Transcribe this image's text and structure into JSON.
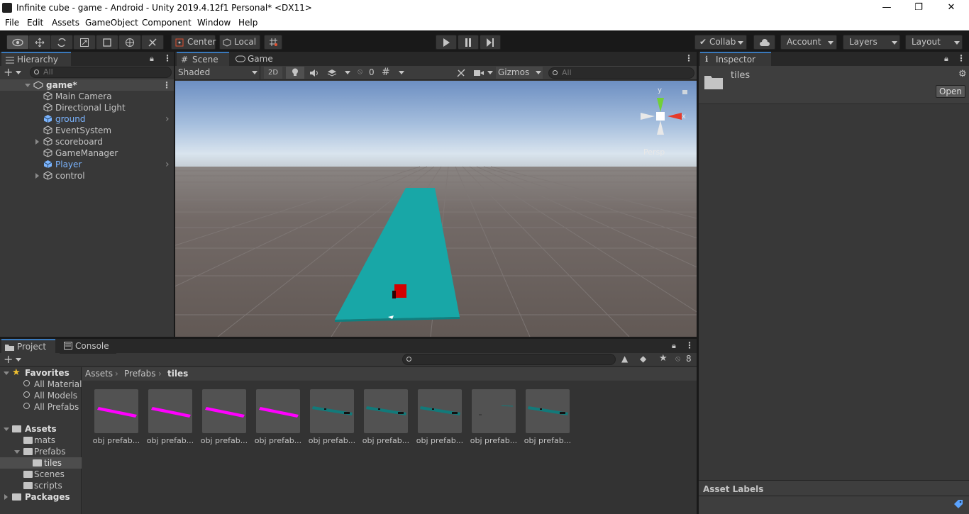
{
  "window": {
    "title": "Infinite cube - game - Android - Unity 2019.4.12f1 Personal* <DX11>"
  },
  "menu": [
    "File",
    "Edit",
    "Assets",
    "GameObject",
    "Component",
    "Window",
    "Help"
  ],
  "toolbar": {
    "center_label": "Center",
    "local_label": "Local",
    "collab_label": "Collab",
    "account_label": "Account",
    "layers_label": "Layers",
    "layout_label": "Layout"
  },
  "hierarchy": {
    "tab": "Hierarchy",
    "search_placeholder": "All",
    "scene": "game*",
    "items": [
      {
        "label": "Main Camera",
        "prefab": false
      },
      {
        "label": "Directional Light",
        "prefab": false
      },
      {
        "label": "ground",
        "prefab": true
      },
      {
        "label": "EventSystem",
        "prefab": false
      },
      {
        "label": "scoreboard",
        "prefab": false
      },
      {
        "label": "GameManager",
        "prefab": false
      },
      {
        "label": "Player",
        "prefab": true
      },
      {
        "label": "control",
        "prefab": false
      }
    ]
  },
  "scene": {
    "tab_scene": "Scene",
    "tab_game": "Game",
    "shading": "Shaded",
    "mode_2d": "2D",
    "hidden_count": "0",
    "gizmos": "Gizmos",
    "search_placeholder": "All",
    "persp": "Persp",
    "axis_y": "y",
    "axis_x": "x"
  },
  "project": {
    "tab_project": "Project",
    "tab_console": "Console",
    "hidden_count": "8",
    "favorites_label": "Favorites",
    "favorites": [
      "All Materials",
      "All Models",
      "All Prefabs"
    ],
    "assets_label": "Assets",
    "folders": [
      "mats",
      "Prefabs",
      "tiles",
      "Scenes",
      "scripts"
    ],
    "packages_label": "Packages",
    "breadcrumb": [
      "Assets",
      "Prefabs",
      "tiles"
    ],
    "items": [
      {
        "label": "obj prefab...",
        "color": "#ff00ff"
      },
      {
        "label": "obj prefab...",
        "color": "#ff00ff"
      },
      {
        "label": "obj prefab...",
        "color": "#ff00ff"
      },
      {
        "label": "obj prefab...",
        "color": "#ff00ff"
      },
      {
        "label": "obj prefab...",
        "color": "#127a7a"
      },
      {
        "label": "obj prefab...",
        "color": "#127a7a"
      },
      {
        "label": "obj prefab...",
        "color": "#127a7a"
      },
      {
        "label": "obj prefab...",
        "color": "#127a7a"
      },
      {
        "label": "obj prefab...",
        "color": "#127a7a"
      }
    ]
  },
  "inspector": {
    "tab": "Inspector",
    "object": "tiles",
    "open_label": "Open",
    "asset_labels": "Asset Labels"
  },
  "colors": {
    "accent": "#3a79bb",
    "prefab": "#7bb4ff",
    "floor": "#18a7a7",
    "player": "#d40000"
  }
}
